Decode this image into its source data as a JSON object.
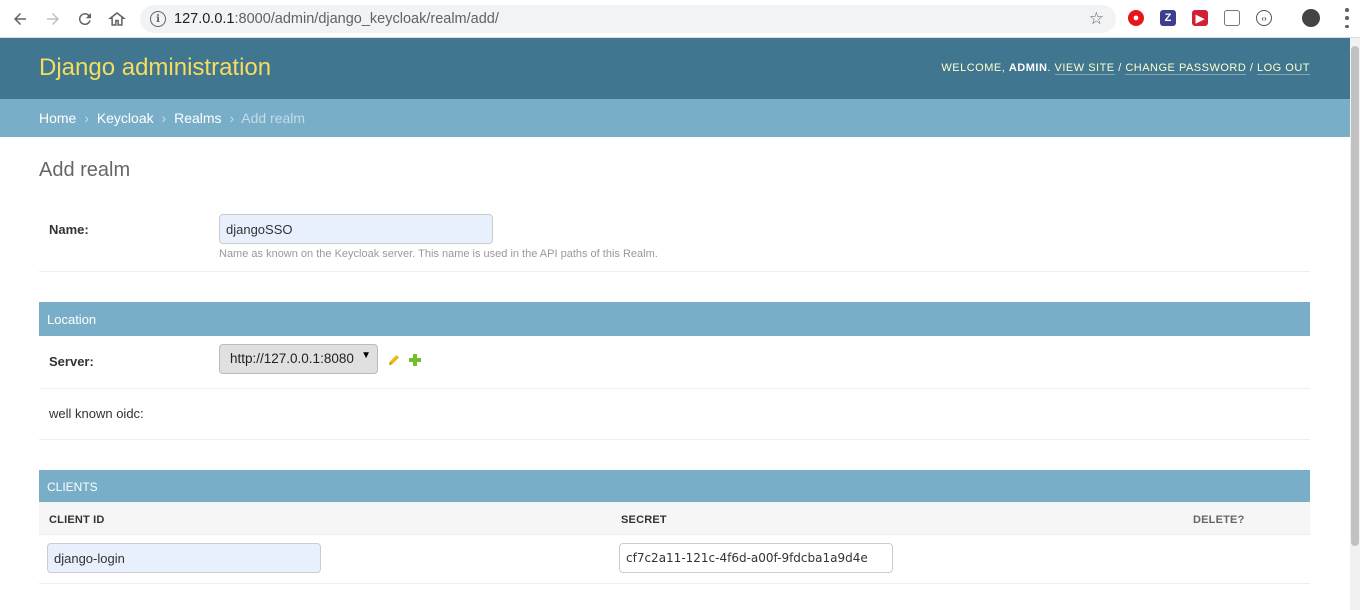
{
  "browser": {
    "url_host": "127.0.0.1",
    "url_rest": ":8000/admin/django_keycloak/realm/add/"
  },
  "header": {
    "site_name": "Django administration",
    "welcome": "Welcome,",
    "username": "admin",
    "view_site": "View site",
    "change_password": "Change password",
    "log_out": "Log out",
    "sep": " / "
  },
  "breadcrumbs": {
    "home": "Home",
    "app": "Keycloak",
    "model": "Realms",
    "current": "Add realm",
    "separator": "›"
  },
  "page": {
    "title": "Add realm"
  },
  "name_field": {
    "label": "Name:",
    "value": "djangoSSO",
    "help": "Name as known on the Keycloak server. This name is used in the API paths of this Realm."
  },
  "location": {
    "caption": "Location",
    "server_label": "Server:",
    "server_value": "http://127.0.0.1:8080",
    "well_known_label": "well known oidc:"
  },
  "clients": {
    "caption": "Clients",
    "columns": [
      "Client ID",
      "Secret",
      "Delete?"
    ],
    "rows": [
      {
        "client_id": "django-login",
        "secret": "cf7c2a11-121c-4f6d-a00f-9fdcba1a9d4e"
      }
    ]
  },
  "colors": {
    "header_bg": "#417690",
    "breadcrumb_bg": "#79aec8",
    "site_name": "#f5dd5d",
    "edit_icon": "#efb80b",
    "add_icon": "#70bf2b"
  }
}
